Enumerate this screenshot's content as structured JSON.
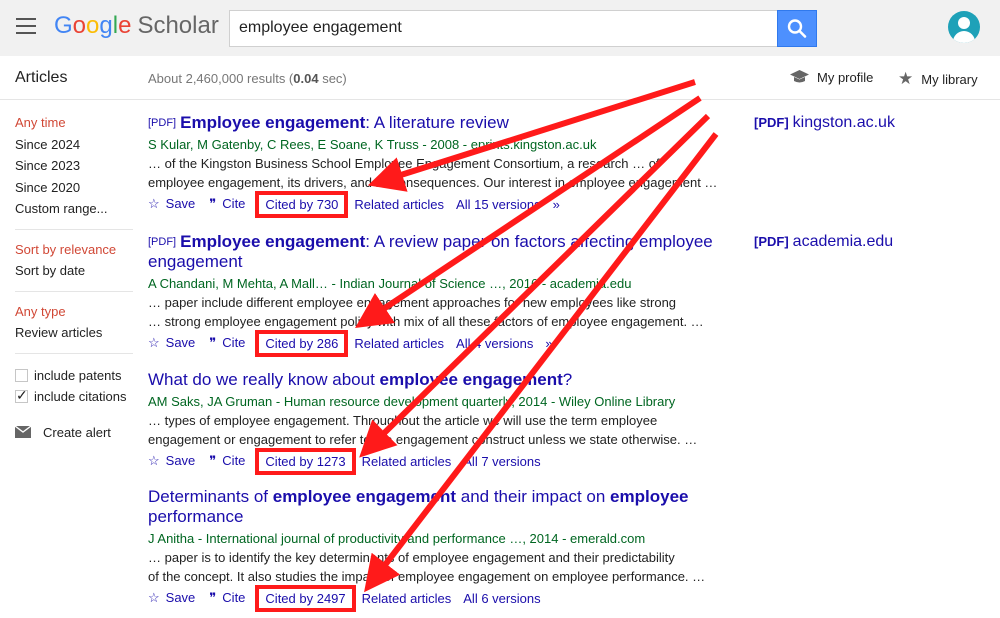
{
  "header": {
    "logo_google": [
      "G",
      "o",
      "o",
      "g",
      "l",
      "e"
    ],
    "logo_scholar": "Scholar",
    "search_value": "employee engagement"
  },
  "subbar": {
    "title": "Articles",
    "results_prefix": "About 2,460,000 results (",
    "results_time": "0.04",
    "results_suffix": " sec)",
    "my_profile": "My profile",
    "my_library": "My library"
  },
  "sidebar": {
    "time_filters": [
      "Any time",
      "Since 2024",
      "Since 2023",
      "Since 2020",
      "Custom range..."
    ],
    "sort_filters": [
      "Sort by relevance",
      "Sort by date"
    ],
    "type_filters": [
      "Any type",
      "Review articles"
    ],
    "include_patents": "include patents",
    "include_citations": "include citations",
    "create_alert": "Create alert"
  },
  "actions": {
    "save": "Save",
    "cite": "Cite",
    "related": "Related articles"
  },
  "results": [
    {
      "pdf": "[PDF]",
      "title_bold": "Employee engagement",
      "title_rest": ": A literature review",
      "authors": "S Kular, M Gatenby, C Rees, E Soane, K Truss - 2008 - eprints.kingston.ac.uk",
      "snippet1": "… of the Kingston Business School Employee Engagement Consortium, a research … of",
      "snippet2": "employee engagement, its drivers, and its consequences. Our interest in employee engagement …",
      "cited": "Cited by 730",
      "versions": "All 15 versions",
      "side_source": "kingston.ac.uk"
    },
    {
      "pdf": "[PDF]",
      "title_bold": "Employee engagement",
      "title_rest": ": A review paper on factors affecting employee engagement",
      "authors": "A Chandani, M Mehta, A Mall… - Indian Journal of Science …, 2016 - academia.edu",
      "snippet1": "… paper include different employee engagement approaches for new employees like strong",
      "snippet2": "… strong employee engagement policy with mix of all these factors of employee engagement. …",
      "cited": "Cited by 286",
      "versions": "All 4 versions",
      "side_source": "academia.edu"
    },
    {
      "title_a": "What do we really know about ",
      "title_bold": "employee engagement",
      "title_rest": "?",
      "authors": "AM Saks, JA Gruman - Human resource development quarterly, 2014 - Wiley Online Library",
      "snippet1": "… types of employee engagement. Throughout the article we will use the term employee",
      "snippet2": "engagement or engagement to refer to the engagement construct unless we state otherwise. …",
      "cited": "Cited by 1273",
      "versions": "All 7 versions"
    },
    {
      "title_a": "Determinants of ",
      "title_bold": "employee engagement",
      "title_rest": " and their impact on ",
      "title_bold2": "employee",
      "title_line2": "performance",
      "authors": "J Anitha - International journal of productivity and performance …, 2014 - emerald.com",
      "snippet1": "… paper is to identify the key determinants of employee engagement and their predictability",
      "snippet2": "of the concept. It also studies the impact of employee engagement on employee performance. …",
      "cited": "Cited by 2497",
      "versions": "All 6 versions"
    }
  ],
  "colors": {
    "annotation": "#ff1a1a",
    "link": "#1a0dab",
    "author_green": "#006621",
    "active_filter": "#d14836"
  }
}
